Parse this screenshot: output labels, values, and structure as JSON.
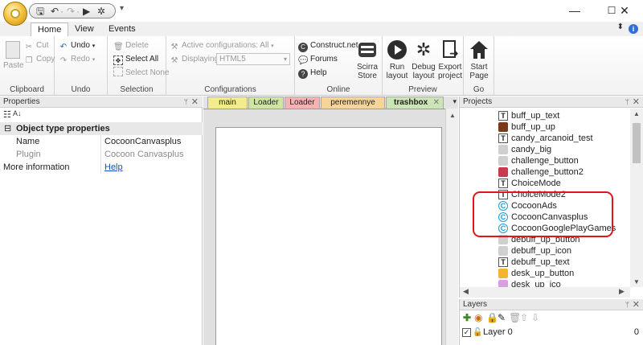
{
  "window": {
    "minimize_glyph": "—",
    "maximize_glyph": "☐",
    "close_glyph": "✕"
  },
  "quick_access": {
    "more_glyph": "▾"
  },
  "ribbon_tabs": [
    "Home",
    "View",
    "Events"
  ],
  "ribbon": {
    "clipboard": {
      "title": "Clipboard",
      "paste": "Paste",
      "cut": "Cut",
      "copy": "Copy"
    },
    "undo": {
      "title": "Undo",
      "undo": "Undo",
      "redo": "Redo"
    },
    "selection": {
      "title": "Selection",
      "delete": "Delete",
      "select_all": "Select All",
      "select_none": "Select None"
    },
    "configurations": {
      "title": "Configurations",
      "active": "Active configurations: All",
      "displaying_label": "Displaying:",
      "displaying_value": "HTML5"
    },
    "online": {
      "title": "Online",
      "constructnet": "Construct.net",
      "forums": "Forums",
      "help": "Help",
      "scirra_store": "Scirra Store"
    },
    "preview": {
      "title": "Preview",
      "run_layout": "Run layout",
      "debug_layout": "Debug layout",
      "export_project": "Export project"
    },
    "go": {
      "title": "Go",
      "start_page": "Start Page"
    }
  },
  "properties": {
    "title": "Properties",
    "section": "Object type properties",
    "rows": [
      {
        "key": "Name",
        "value": "CocoonCanvasplus"
      },
      {
        "key": "Plugin",
        "value": "Cocoon Canvasplus"
      }
    ],
    "more_info_label": "More information",
    "more_info_link": "Help"
  },
  "editor": {
    "tabs": [
      {
        "label": "main",
        "color": "#f3ec8a"
      },
      {
        "label": "Loader",
        "color": "#cfe6a3"
      },
      {
        "label": "Loader",
        "color": "#f7b3b3"
      },
      {
        "label": "peremennye",
        "color": "#f6d49a"
      },
      {
        "label": "trashbox",
        "color": "#cbe5b6",
        "active": true
      }
    ]
  },
  "projects": {
    "title": "Projects",
    "items": [
      {
        "label": "buff_up_text",
        "icon": "text-icon"
      },
      {
        "label": "buff_up_up",
        "icon": "sprite-icon"
      },
      {
        "label": "candy_arcanoid_test",
        "icon": "text-icon"
      },
      {
        "label": "candy_big",
        "icon": "sprite-icon"
      },
      {
        "label": "challenge_button",
        "icon": "sprite-icon"
      },
      {
        "label": "challenge_button2",
        "icon": "sprite-icon"
      },
      {
        "label": "ChoiceMode",
        "icon": "text-icon"
      },
      {
        "label": "ChoiceMode2",
        "icon": "text-icon"
      },
      {
        "label": "CocoonAds",
        "icon": "cocoon-icon"
      },
      {
        "label": "CocoonCanvasplus",
        "icon": "cocoon-icon"
      },
      {
        "label": "CocoonGooglePlayGames",
        "icon": "cocoon-icon"
      },
      {
        "label": "debuff_up_button",
        "icon": "sprite-icon"
      },
      {
        "label": "debuff_up_icon",
        "icon": "sprite-icon"
      },
      {
        "label": "debuff_up_text",
        "icon": "text-icon"
      },
      {
        "label": "desk_up_button",
        "icon": "sprite-icon"
      },
      {
        "label": "desk_up_ico",
        "icon": "sprite-icon"
      }
    ]
  },
  "layers": {
    "title": "Layers",
    "rows": [
      {
        "name": "Layer 0",
        "index": "0"
      }
    ]
  },
  "colors": {
    "highlight": "#e0161c",
    "cocoon_blue": "#1a9fd6"
  }
}
